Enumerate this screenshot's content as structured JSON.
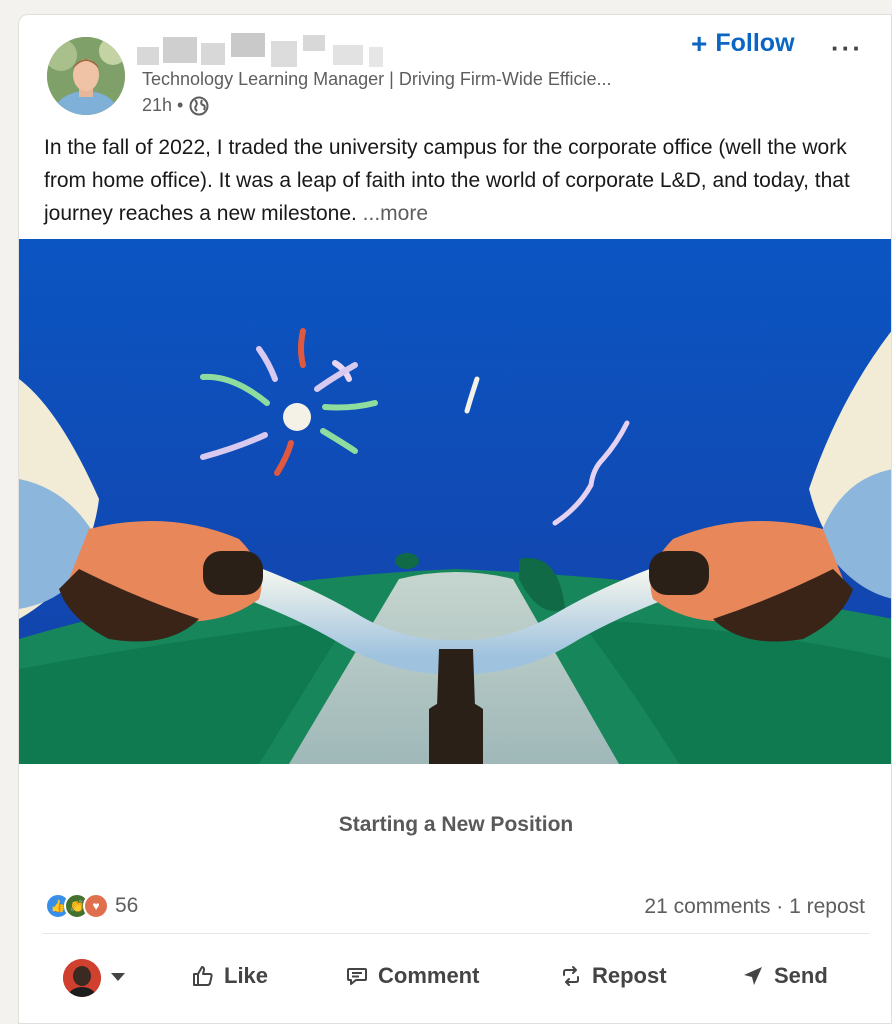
{
  "post": {
    "author_subtitle": "Technology Learning Manager | Driving Firm-Wide Efficie...",
    "time": "21h •",
    "follow_label": "Follow",
    "more_menu": "···",
    "text": "In the fall of 2022, I traded the university campus for the corporate office (well the work from home office). It was a leap of faith into the world of corporate L&D, and today, that journey reaches a new milestone. ",
    "see_more": "...more",
    "caption": "Starting a New Position"
  },
  "social": {
    "reaction_count": "56",
    "stats": "21 comments · 1 repost"
  },
  "actions": {
    "like": "Like",
    "comment": "Comment",
    "repost": "Repost",
    "send": "Send"
  },
  "colors": {
    "accent": "#0a66c2",
    "sky": "#0b54c0",
    "grass": "#17865a"
  },
  "icons": [
    "globe-icon",
    "plus-icon",
    "more-icon",
    "like-icon",
    "comment-icon",
    "repost-icon",
    "send-icon"
  ]
}
